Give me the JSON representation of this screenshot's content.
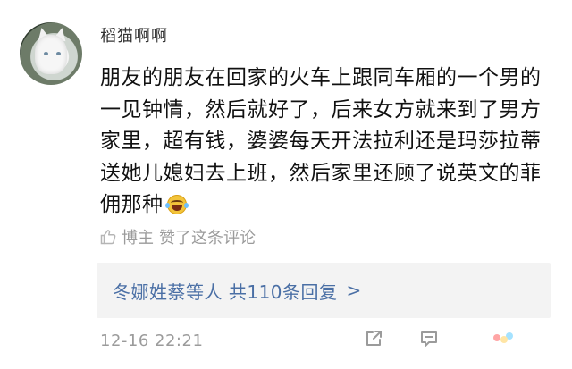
{
  "comment": {
    "username": "稻猫啊啊",
    "text": "朋友的朋友在回家的火车上跟同车厢的一个男的一见钟情，然后就好了，后来女方就来到了男方家里，超有钱，婆婆每天开法拉利还是玛莎拉蒂送她儿媳妇去上班，然后家里还顾了说英文的菲佣那种",
    "emoji": "laugh-cry-emoji",
    "liked_by_author": {
      "author_label": "博主",
      "text": "赞了这条评论"
    },
    "replies": {
      "text": "冬娜姓蔡等人 共110条回复",
      "chevron": ">"
    },
    "timestamp": "12-16 22:21"
  },
  "icons": {
    "share": "share-icon",
    "reply": "comment-icon",
    "thumb": "thumbs-up-icon"
  }
}
